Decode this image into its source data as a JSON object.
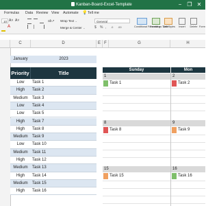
{
  "window": {
    "title": "Kanban-Board-Excel-Template",
    "minimize": "−",
    "restore": "❐",
    "close": "✕"
  },
  "menu": [
    "Formulas",
    "Data",
    "Review",
    "View",
    "Automate",
    "Tell me"
  ],
  "ribbon": {
    "font_size": "10",
    "wrap_text": "Wrap Text",
    "number_format": "General",
    "merge_center": "Merge & Center",
    "conditional_formatting": "Conditional Formatting",
    "format_as_table": "Format as Table",
    "cell_styles": "Cell Styles",
    "insert": "Insert",
    "delete": "Delete",
    "format": "Form"
  },
  "columns": [
    "C",
    "D",
    "E",
    "F",
    "G",
    "H"
  ],
  "sheet": {
    "month": "January",
    "year": "2023",
    "priority_header": "Priority",
    "title_header": "Title",
    "rows": [
      {
        "priority": "Low",
        "task": "Task 1"
      },
      {
        "priority": "High",
        "task": "Task 2"
      },
      {
        "priority": "Medium",
        "task": "Task 3"
      },
      {
        "priority": "Low",
        "task": "Task 4"
      },
      {
        "priority": "Low",
        "task": "Task 5"
      },
      {
        "priority": "High",
        "task": "Task 7"
      },
      {
        "priority": "High",
        "task": "Task 8"
      },
      {
        "priority": "Medium",
        "task": "Task 9"
      },
      {
        "priority": "Low",
        "task": "Task 10"
      },
      {
        "priority": "Medium",
        "task": "Task 11"
      },
      {
        "priority": "High",
        "task": "Task 12"
      },
      {
        "priority": "Medium",
        "task": "Task 13"
      },
      {
        "priority": "High",
        "task": "Task 14"
      },
      {
        "priority": "Medium",
        "task": "Task 15"
      },
      {
        "priority": "High",
        "task": "Task 16"
      }
    ]
  },
  "calendar": {
    "day_headers": [
      "Sunday",
      "Mon"
    ],
    "cells": [
      {
        "day": "1",
        "task": "Task 1",
        "color": "#7fbf6a"
      },
      {
        "day": "2",
        "task": "Task 2",
        "color": "#e05555"
      },
      {
        "day": "8",
        "task": "Task 8",
        "color": "#e05555"
      },
      {
        "day": "9",
        "task": "Task 9",
        "color": "#f0a060"
      },
      {
        "day": "15",
        "task": "Task 15",
        "color": "#f0a060"
      },
      {
        "day": "16",
        "task": "Task 16",
        "color": "#7fbf6a"
      }
    ]
  },
  "colors": {
    "excel_green": "#217346",
    "navy_header": "#1d3640",
    "month_fill": "#dbe5f1",
    "row_band": "#dce6f1",
    "day_band": "#d9d9d9"
  }
}
